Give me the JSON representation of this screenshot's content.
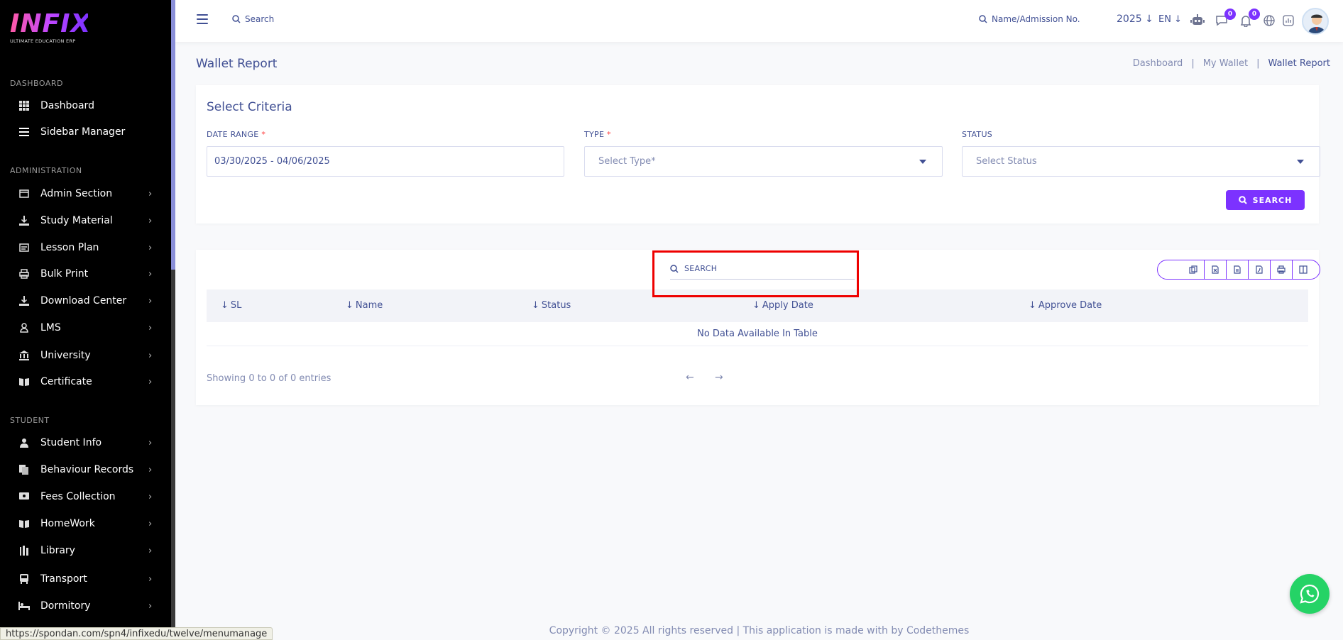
{
  "brand": {
    "logo_text": "INFIX",
    "logo_sub": "ULTIMATE EDUCATION ERP"
  },
  "sidebar": {
    "sections": [
      {
        "title": "DASHBOARD"
      },
      {
        "title": "ADMINISTRATION"
      },
      {
        "title": "STUDENT"
      }
    ],
    "items": [
      {
        "label": "Dashboard",
        "icon": "grid-icon"
      },
      {
        "label": "Sidebar Manager",
        "icon": "menu-icon"
      },
      {
        "label": "Admin Section",
        "icon": "admin-icon"
      },
      {
        "label": "Study Material",
        "icon": "download-icon"
      },
      {
        "label": "Lesson Plan",
        "icon": "lesson-icon"
      },
      {
        "label": "Bulk Print",
        "icon": "printer-icon"
      },
      {
        "label": "Download Center",
        "icon": "download-icon"
      },
      {
        "label": "LMS",
        "icon": "lms-icon"
      },
      {
        "label": "University",
        "icon": "university-icon"
      },
      {
        "label": "Certificate",
        "icon": "book-icon"
      },
      {
        "label": "Student Info",
        "icon": "user-icon"
      },
      {
        "label": "Behaviour Records",
        "icon": "records-icon"
      },
      {
        "label": "Fees Collection",
        "icon": "fees-icon"
      },
      {
        "label": "HomeWork",
        "icon": "book-icon"
      },
      {
        "label": "Library",
        "icon": "library-icon"
      },
      {
        "label": "Transport",
        "icon": "bus-icon"
      },
      {
        "label": "Dormitory",
        "icon": "bed-icon"
      }
    ]
  },
  "topbar": {
    "search_label": "Search",
    "admission_search": "Name/Admission No.",
    "year": "2025",
    "language": "EN",
    "messages_badge": "0",
    "notifications_badge": "0"
  },
  "page": {
    "title": "Wallet Report",
    "breadcrumb": [
      "Dashboard",
      "My Wallet",
      "Wallet Report"
    ],
    "breadcrumb_sep": "|"
  },
  "criteria": {
    "title": "Select Criteria",
    "date_range_label": "DATE RANGE",
    "date_range_value": "03/30/2025 - 04/06/2025",
    "type_label": "TYPE",
    "type_placeholder": "Select Type*",
    "status_label": "STATUS",
    "status_placeholder": "Select Status",
    "required_mark": "*",
    "search_button": "SEARCH"
  },
  "table": {
    "search_placeholder": "SEARCH",
    "columns": [
      "SL",
      "Name",
      "Status",
      "Apply Date",
      "Approve Date"
    ],
    "empty_text": "No Data Available In Table",
    "showing_text": "Showing 0 to 0 of 0 entries",
    "prev": "←",
    "next": "→",
    "export_buttons": [
      "copy-icon",
      "excel-icon",
      "csv-icon",
      "pdf-icon",
      "print-icon",
      "columns-icon"
    ]
  },
  "footer": {
    "text": "Copyright © 2025 All rights reserved | This application is made with by Codethemes"
  },
  "status_bar": {
    "url": "https://spondan.com/spn4/infixedu/twelve/menumanage"
  },
  "colors": {
    "accent": "#7c32ff",
    "text": "#415094",
    "highlight": "#ee0000",
    "whatsapp": "#25d366"
  }
}
